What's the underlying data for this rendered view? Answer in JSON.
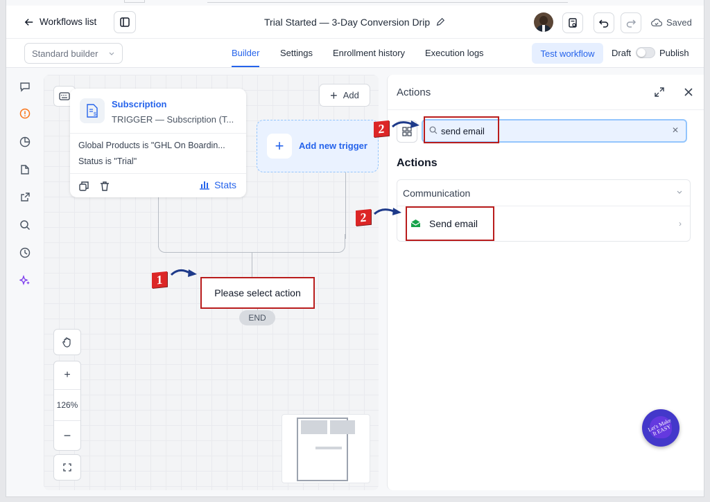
{
  "header": {
    "back_label": "Workflows list",
    "workflow_title": "Trial Started — 3-Day Conversion Drip",
    "saved_label": "Saved"
  },
  "subheader": {
    "builder_mode": "Standard builder",
    "tabs": [
      {
        "label": "Builder",
        "active": true
      },
      {
        "label": "Settings"
      },
      {
        "label": "Enrollment history"
      },
      {
        "label": "Execution logs"
      }
    ],
    "test_workflow_label": "Test workflow",
    "draft_label": "Draft",
    "publish_label": "Publish"
  },
  "canvas": {
    "add_label": "Add",
    "trigger": {
      "name": "Subscription",
      "subtitle": "TRIGGER — Subscription (T...",
      "conditions": [
        "Global Products is \"GHL On Boardin...",
        "Status is \"Trial\""
      ],
      "stats_label": "Stats"
    },
    "add_trigger_label": "Add new trigger",
    "placeholder_action": "Please select action",
    "end_label": "END",
    "zoom_level": "126%"
  },
  "annotations": {
    "step1": "1",
    "step2": "2"
  },
  "actions_panel": {
    "title": "Actions",
    "search_value": "send email",
    "section_title": "Actions",
    "group_label": "Communication",
    "item_label": "Send email"
  },
  "watermark": {
    "text": "Let's Make It EASY"
  },
  "colors": {
    "accent": "#2563eb",
    "annotation_red": "#b91c1c",
    "email_green": "#16a34a"
  }
}
